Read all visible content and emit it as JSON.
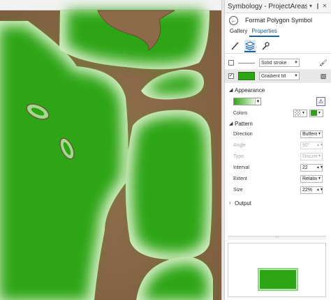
{
  "pane": {
    "title": "Symbology - ProjectAreas",
    "pin_icon": "pin-icon",
    "close_icon": "close-icon",
    "back_icon": "back-arrow-icon",
    "subtitle": "Format Polygon Symbol",
    "tabs": [
      {
        "label": "Gallery"
      },
      {
        "label": "Properties"
      }
    ],
    "tools": [
      "brush-icon",
      "layers-icon",
      "wrench-icon"
    ]
  },
  "layers": [
    {
      "checked": false,
      "symbol_type": "Solid stroke",
      "action_icon": "paint-bucket-icon"
    },
    {
      "checked": true,
      "symbol_type": "Gradient fill",
      "action_icon": "eraser-icon",
      "color": "#2ea515"
    }
  ],
  "appearance": {
    "header": "Appearance",
    "colors_label": "Colors",
    "swatch_color": "#2ea515"
  },
  "pattern": {
    "header": "Pattern",
    "direction": {
      "label": "Direction",
      "value": "Buffered"
    },
    "angle": {
      "label": "Angle",
      "value": "90°"
    },
    "type": {
      "label": "Type",
      "value": "Discrete"
    },
    "interval": {
      "label": "Interval",
      "value": "22"
    },
    "extent": {
      "label": "Extent",
      "value": "Relative"
    },
    "size": {
      "label": "Size",
      "value": "22%"
    }
  },
  "output": {
    "header": "Output"
  },
  "colors": {
    "fill": "#2ea515",
    "accent": "#1a5fa6",
    "ground": "#8d6a4a"
  }
}
